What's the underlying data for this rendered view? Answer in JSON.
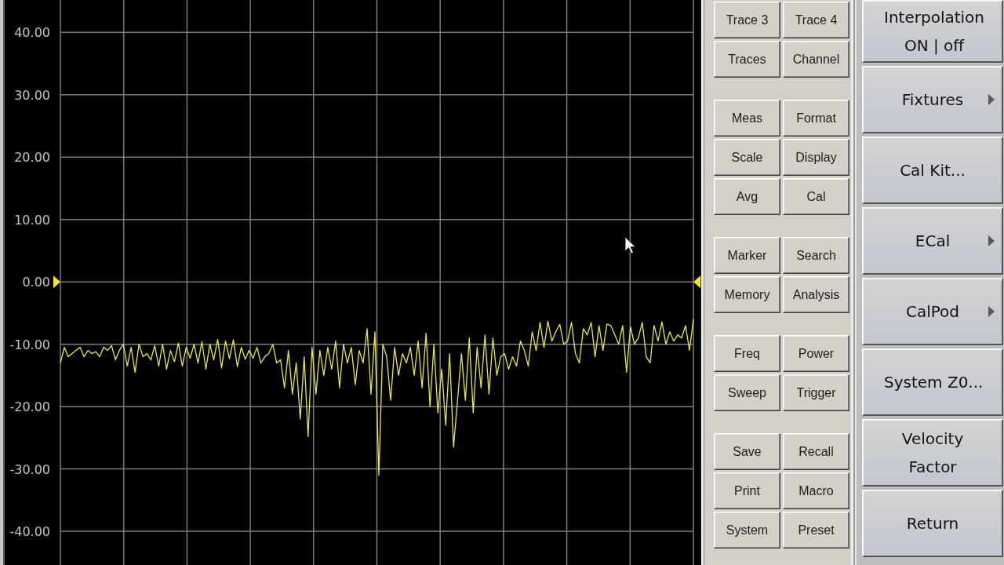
{
  "plot": {
    "chart_data": {
      "type": "line",
      "grid": true,
      "ylim": [
        -45.4,
        45.2
      ],
      "yticks": [
        {
          "value": 40,
          "label": "40.00"
        },
        {
          "value": 30,
          "label": "30.00"
        },
        {
          "value": 20,
          "label": "20.00"
        },
        {
          "value": 10,
          "label": "10.00"
        },
        {
          "value": 0,
          "label": "0.00"
        },
        {
          "value": -10,
          "label": "-10.00"
        },
        {
          "value": -20,
          "label": "-20.00"
        },
        {
          "value": -30,
          "label": "-30.00"
        },
        {
          "value": -40,
          "label": "-40.00"
        }
      ],
      "values": [
        -13,
        -10.5,
        -12,
        -11.5,
        -11,
        -10.5,
        -12,
        -11,
        -11.5,
        -11.2,
        -12,
        -10.5,
        -11,
        -10.2,
        -12.5,
        -11,
        -10,
        -13.5,
        -10.5,
        -14.5,
        -10,
        -12,
        -11.5,
        -12.5,
        -10.2,
        -13.5,
        -10,
        -14,
        -11,
        -12.8,
        -9.8,
        -13.5,
        -10.5,
        -12.2,
        -10,
        -13,
        -9.6,
        -14,
        -10,
        -12.5,
        -9.2,
        -13.8,
        -9.5,
        -12.3,
        -9.3,
        -13.6,
        -10.5,
        -12.4,
        -11,
        -12.2,
        -10.5,
        -13,
        -12,
        -11.5,
        -10,
        -13,
        -12.5,
        -17,
        -11,
        -18,
        -13,
        -22,
        -12,
        -24.8,
        -10.5,
        -18,
        -11,
        -15,
        -10.5,
        -14,
        -9.5,
        -17,
        -10,
        -13,
        -10.5,
        -16.5,
        -11,
        -13,
        -7.5,
        -18,
        -8,
        -31,
        -10,
        -12,
        -19,
        -10.5,
        -15,
        -11.5,
        -13,
        -10.5,
        -15,
        -9.5,
        -17,
        -8.2,
        -20,
        -10,
        -21,
        -14,
        -23,
        -11.5,
        -26.5,
        -19,
        -11.5,
        -19,
        -9,
        -21,
        -10.5,
        -17,
        -8.5,
        -18,
        -9,
        -15,
        -12,
        -11.5,
        -14,
        -12,
        -13.5,
        -9.5,
        -11,
        -13.5,
        -8,
        -11,
        -6.5,
        -10.5,
        -6.3,
        -9.5,
        -8,
        -6.8,
        -10,
        -9.5,
        -6.5,
        -11.5,
        -13,
        -7.5,
        -8.5,
        -6.5,
        -12,
        -7,
        -11,
        -6.8,
        -7,
        -8.5,
        -10,
        -7,
        -14.5,
        -7.2,
        -10,
        -9,
        -6.5,
        -12,
        -13,
        -7,
        -9.5,
        -6.4,
        -10,
        -8,
        -9.5,
        -8.5,
        -9,
        -7,
        -11,
        -6
      ]
    }
  },
  "hardkey_panel": {
    "groups": [
      {
        "buttons": [
          "Trace 3",
          "Trace 4",
          "Traces",
          "Channel"
        ]
      },
      {
        "buttons": [
          "Meas",
          "Format",
          "Scale",
          "Display",
          "Avg",
          "Cal"
        ]
      },
      {
        "buttons": [
          "Marker",
          "Search",
          "Memory",
          "Analysis"
        ]
      },
      {
        "buttons": [
          "Freq",
          "Power",
          "Sweep",
          "Trigger"
        ]
      },
      {
        "buttons": [
          "Save",
          "Recall",
          "Print",
          "Macro",
          "System",
          "Preset"
        ]
      }
    ]
  },
  "softkeys": [
    {
      "lines": [
        "Interpolation",
        "ON | off"
      ],
      "submenu": false
    },
    {
      "lines": [
        "Fixtures"
      ],
      "submenu": true
    },
    {
      "lines": [
        "Cal Kit..."
      ],
      "submenu": false
    },
    {
      "lines": [
        "ECal"
      ],
      "submenu": true
    },
    {
      "lines": [
        "CalPod"
      ],
      "submenu": true
    },
    {
      "lines": [
        "System Z0..."
      ],
      "submenu": false
    },
    {
      "lines": [
        "Velocity",
        "Factor"
      ],
      "submenu": false
    },
    {
      "lines": [
        "Return"
      ],
      "submenu": false
    }
  ]
}
